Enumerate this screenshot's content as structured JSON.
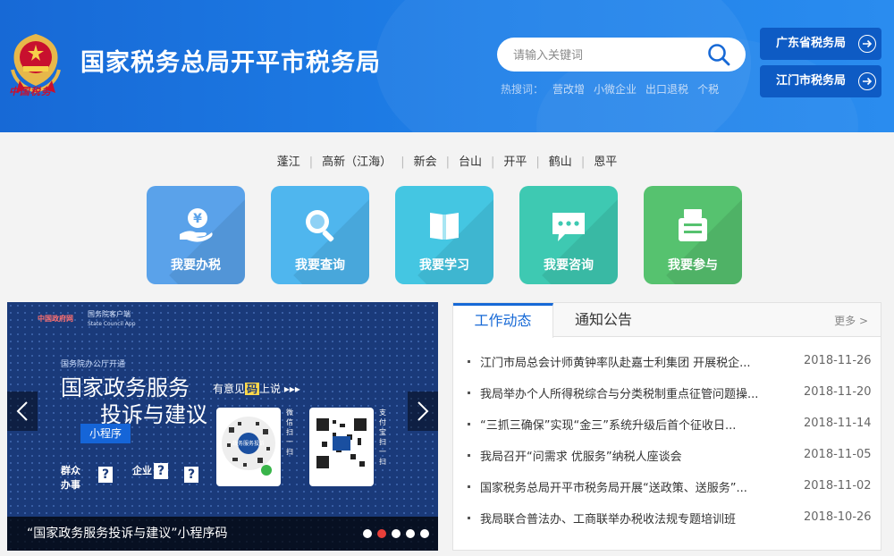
{
  "header": {
    "site_title": "国家税务总局开平市税务局",
    "emblem_text": "中国税务",
    "search": {
      "placeholder": "请输入关键词"
    },
    "hot_label": "热搜词：",
    "hot_words": [
      "营改增",
      "小微企业",
      "出口退税",
      "个税"
    ],
    "links": [
      {
        "label": "广东省税务局"
      },
      {
        "label": "江门市税务局"
      }
    ]
  },
  "city_nav": [
    "蓬江",
    "高新（江海）",
    "新会",
    "台山",
    "开平",
    "鹤山",
    "恩平"
  ],
  "services": [
    {
      "label": "我要办税",
      "color": "#5aa2ea",
      "icon": "tax-money-icon"
    },
    {
      "label": "我要查询",
      "color": "#4fb6ee",
      "icon": "magnifier-icon"
    },
    {
      "label": "我要学习",
      "color": "#44c6e2",
      "icon": "book-icon"
    },
    {
      "label": "我要咨询",
      "color": "#3ec9b2",
      "icon": "chat-icon"
    },
    {
      "label": "我要参与",
      "color": "#56c26f",
      "icon": "ballot-box-icon"
    }
  ],
  "banner": {
    "logo_a": "中国政府网",
    "logo_b": "国务院客户端",
    "logo_b_sub": "State Council App",
    "small_top": "国务院办公厅开通",
    "big_line1": "国家政务服务",
    "big_line2": "投诉与建议",
    "mini_tag": "小程序",
    "feedback_pre": "有意见",
    "feedback_hl": "码",
    "feedback_post": "上说",
    "wechat_scan": "微信扫一扫",
    "alipay_scan": "支付宝扫一扫",
    "pair1_a": "群众",
    "pair1_b": "办事",
    "pair2_a": "企业",
    "qr_badge": "政务服务投诉",
    "caption": "“国家政务服务投诉与建议”小程序码",
    "pager_count": 5,
    "pager_active": 1
  },
  "news": {
    "tab_active": "工作动态",
    "tab_other": "通知公告",
    "more": "更多 >",
    "items": [
      {
        "title": "江门市局总会计师黄钟率队赴嘉士利集团 开展税企...",
        "date": "2018-11-26"
      },
      {
        "title": "我局举办个人所得税综合与分类税制重点征管问题操...",
        "date": "2018-11-20"
      },
      {
        "title": "“三抓三确保”实现“金三”系统升级后首个征收日...",
        "date": "2018-11-14"
      },
      {
        "title": "我局召开“问需求 优服务”纳税人座谈会",
        "date": "2018-11-05"
      },
      {
        "title": "国家税务总局开平市税务局开展“送政策、送服务”...",
        "date": "2018-11-02"
      },
      {
        "title": "我局联合普法办、工商联举办税收法规专题培训班",
        "date": "2018-10-26"
      }
    ]
  }
}
